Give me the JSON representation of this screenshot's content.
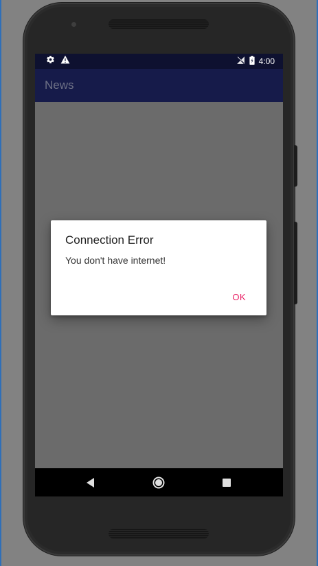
{
  "status_bar": {
    "left_icons": [
      "gear-icon",
      "warning-icon"
    ],
    "right_icons": [
      "no-signal-icon",
      "battery-icon"
    ],
    "time": "4:00"
  },
  "app_bar": {
    "title": "News"
  },
  "dialog": {
    "title": "Connection Error",
    "message": "You don't have internet!",
    "ok_label": "OK"
  },
  "nav_bar": {
    "buttons": [
      "back-icon",
      "home-icon",
      "recents-icon"
    ]
  },
  "colors": {
    "status_bar": "#0e1130",
    "app_bar": "#161b4a",
    "scrim": "#6b6b6b",
    "dialog_button": "#e91e63"
  }
}
